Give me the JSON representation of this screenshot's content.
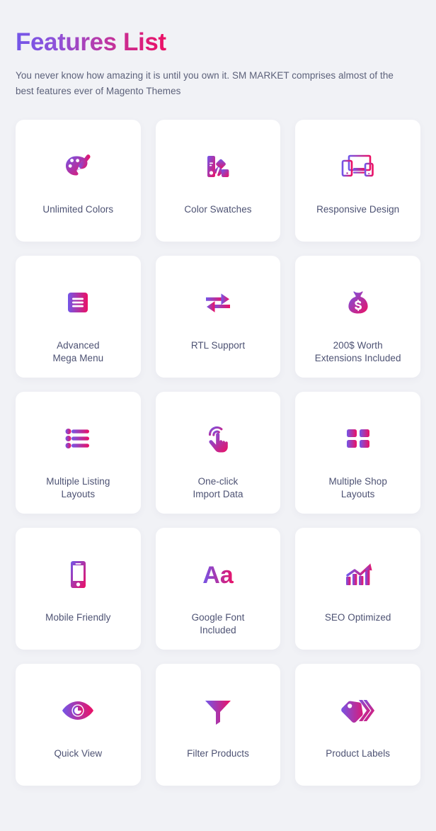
{
  "header": {
    "title": "Features List",
    "subtitle": "You never know how amazing it is until you own it. SM MARKET comprises almost of the best features ever of Magento Themes"
  },
  "theme": {
    "background": "#f1f2f6",
    "card_background": "#ffffff",
    "text_color": "#4d5273",
    "gradient_start": "#7356e8",
    "gradient_end": "#ec1064"
  },
  "features": [
    {
      "label": "Unlimited Colors",
      "icon": "palette-icon"
    },
    {
      "label": "Color Swatches",
      "icon": "color-swatches-icon"
    },
    {
      "label": "Responsive Design",
      "icon": "responsive-devices-icon"
    },
    {
      "label": "Advanced\nMega Menu",
      "icon": "hamburger-menu-icon"
    },
    {
      "label": "RTL Support",
      "icon": "bidirectional-arrows-icon"
    },
    {
      "label": "200$ Worth\nExtensions Included",
      "icon": "money-bag-icon"
    },
    {
      "label": "Multiple Listing\nLayouts",
      "icon": "bullet-list-icon"
    },
    {
      "label": "One-click\nImport Data",
      "icon": "click-hand-icon"
    },
    {
      "label": "Multiple Shop\nLayouts",
      "icon": "grid-layout-icon"
    },
    {
      "label": "Mobile Friendly",
      "icon": "mobile-phone-icon"
    },
    {
      "label": "Google Font\nIncluded",
      "icon": "font-aa-icon"
    },
    {
      "label": "SEO Optimized",
      "icon": "growth-chart-icon"
    },
    {
      "label": "Quick View",
      "icon": "eye-icon"
    },
    {
      "label": "Filter Products",
      "icon": "funnel-icon"
    },
    {
      "label": "Product Labels",
      "icon": "price-tags-icon"
    }
  ]
}
